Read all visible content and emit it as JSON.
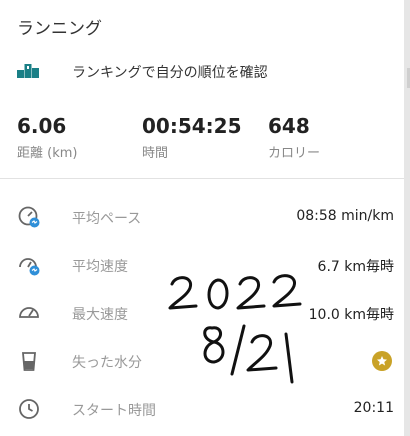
{
  "header": {
    "title": "ランニング"
  },
  "ranking": {
    "label": "ランキングで自分の順位を確認",
    "icon": "podium-icon"
  },
  "stats": [
    {
      "value": "6.06",
      "caption": "距離 (km)"
    },
    {
      "value": "00:54:25",
      "caption": "時間"
    },
    {
      "value": "648",
      "caption": "カロリー"
    }
  ],
  "metrics": [
    {
      "label": "平均ペース",
      "value": "08:58 min/km",
      "icon": "pace-icon"
    },
    {
      "label": "平均速度",
      "value": "6.7 km毎時",
      "icon": "speed-icon"
    },
    {
      "label": "最大速度",
      "value": "10.0 km毎時",
      "icon": "max-speed-icon"
    },
    {
      "label": "失った水分",
      "value": "",
      "icon": "water-glass-icon",
      "badge": "star-icon"
    },
    {
      "label": "スタート時間",
      "value": "20:11",
      "icon": "clock-icon"
    }
  ],
  "handwriting": {
    "line1": "2022",
    "line2": "8/21"
  },
  "colors": {
    "accent": "#1a7f86",
    "star_badge": "#c9a227",
    "icon_blue": "#2f8fd8"
  }
}
